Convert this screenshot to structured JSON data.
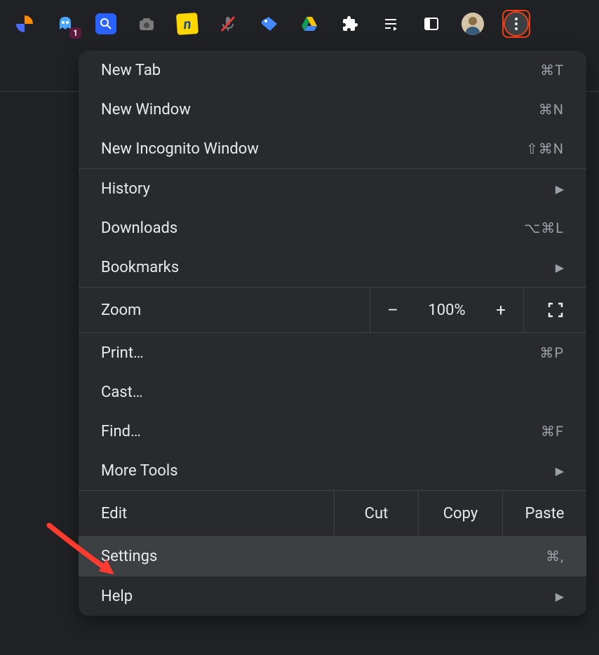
{
  "toolbar": {
    "extensions": [
      {
        "name": "similarweb",
        "color1": "#ff8a00",
        "color2": "#4a6bff"
      },
      {
        "name": "ghostery",
        "color": "#4aa8ff",
        "badge": "1"
      },
      {
        "name": "search-ext",
        "color": "#2962ff"
      },
      {
        "name": "screenshot",
        "color": "#9e9e9e"
      },
      {
        "name": "notion",
        "color": "#ffd600"
      },
      {
        "name": "mic-muted",
        "color": "#e53935"
      },
      {
        "name": "tag",
        "color": "#448aff"
      },
      {
        "name": "google-drive"
      },
      {
        "name": "extensions-puzzle",
        "color": "#ffffff"
      },
      {
        "name": "media-control",
        "color": "#ffffff"
      },
      {
        "name": "side-panel",
        "color": "#ffffff"
      }
    ]
  },
  "menu": {
    "items": [
      {
        "label": "New Tab",
        "shortcut": "⌘T"
      },
      {
        "label": "New Window",
        "shortcut": "⌘N"
      },
      {
        "label": "New Incognito Window",
        "shortcut": "⇧⌘N"
      }
    ],
    "history": {
      "label": "History"
    },
    "downloads": {
      "label": "Downloads",
      "shortcut": "⌥⌘L"
    },
    "bookmarks": {
      "label": "Bookmarks"
    },
    "zoom": {
      "label": "Zoom",
      "value": "100%"
    },
    "print": {
      "label": "Print…",
      "shortcut": "⌘P"
    },
    "cast": {
      "label": "Cast…"
    },
    "find": {
      "label": "Find…",
      "shortcut": "⌘F"
    },
    "moretools": {
      "label": "More Tools"
    },
    "edit": {
      "label": "Edit",
      "cut": "Cut",
      "copy": "Copy",
      "paste": "Paste"
    },
    "settings": {
      "label": "Settings",
      "shortcut": "⌘,"
    },
    "help": {
      "label": "Help"
    }
  }
}
